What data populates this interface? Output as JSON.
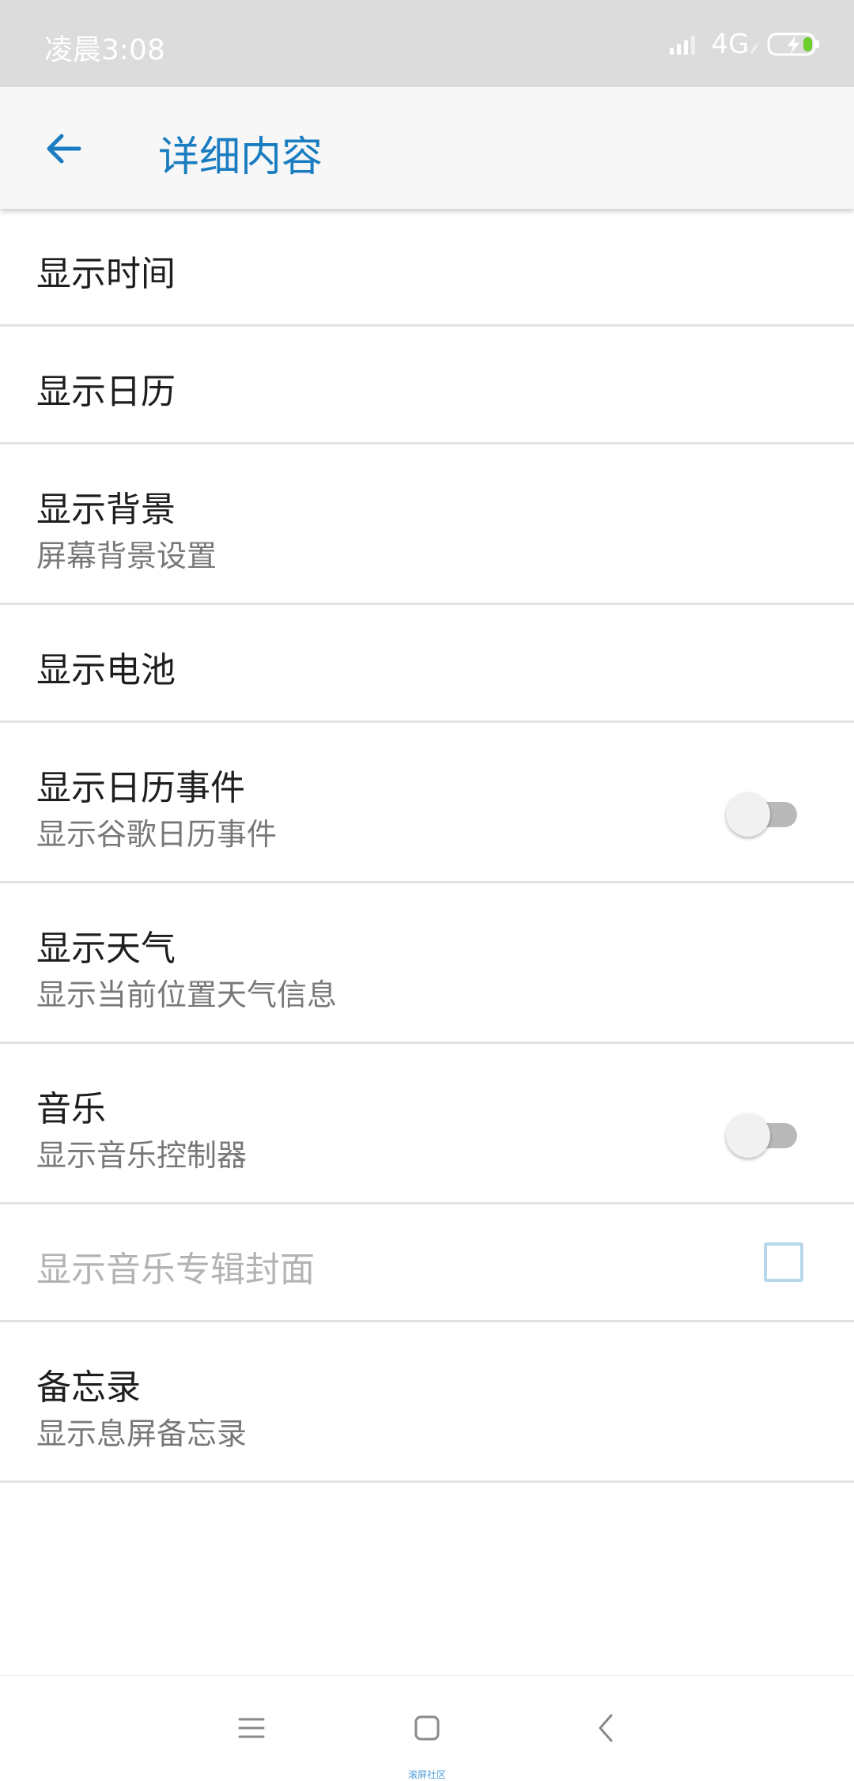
{
  "status_bar": {
    "time": "凌晨3:08",
    "network": "4G",
    "network_sub": "⁄⁄"
  },
  "app_bar": {
    "title": "详细内容",
    "back_icon": "arrow-back-icon"
  },
  "settings": [
    {
      "title": "显示时间",
      "subtitle": null,
      "control": null
    },
    {
      "title": "显示日历",
      "subtitle": null,
      "control": null
    },
    {
      "title": "显示背景",
      "subtitle": "屏幕背景设置",
      "control": null
    },
    {
      "title": "显示电池",
      "subtitle": null,
      "control": null
    },
    {
      "title": "显示日历事件",
      "subtitle": "显示谷歌日历事件",
      "control": "toggle",
      "checked": false
    },
    {
      "title": "显示天气",
      "subtitle": "显示当前位置天气信息",
      "control": null
    },
    {
      "title": "音乐",
      "subtitle": "显示音乐控制器",
      "control": "toggle",
      "checked": false
    },
    {
      "title": "显示音乐专辑封面",
      "subtitle": null,
      "control": "checkbox",
      "checked": false,
      "disabled": true
    },
    {
      "title": "备忘录",
      "subtitle": "显示息屏备忘录",
      "control": null
    }
  ],
  "nav_bar": {
    "menu_icon": "menu-icon",
    "home_icon": "home-icon",
    "back_icon": "back-chevron-icon",
    "watermark": "滚屏社区"
  },
  "colors": {
    "accent": "#1a7dc1",
    "status_bar_bg": "#dcdcdc",
    "app_bar_bg": "#f7f7f7",
    "divider": "#e2e2e2",
    "battery_charge": "#6ccf2c"
  }
}
